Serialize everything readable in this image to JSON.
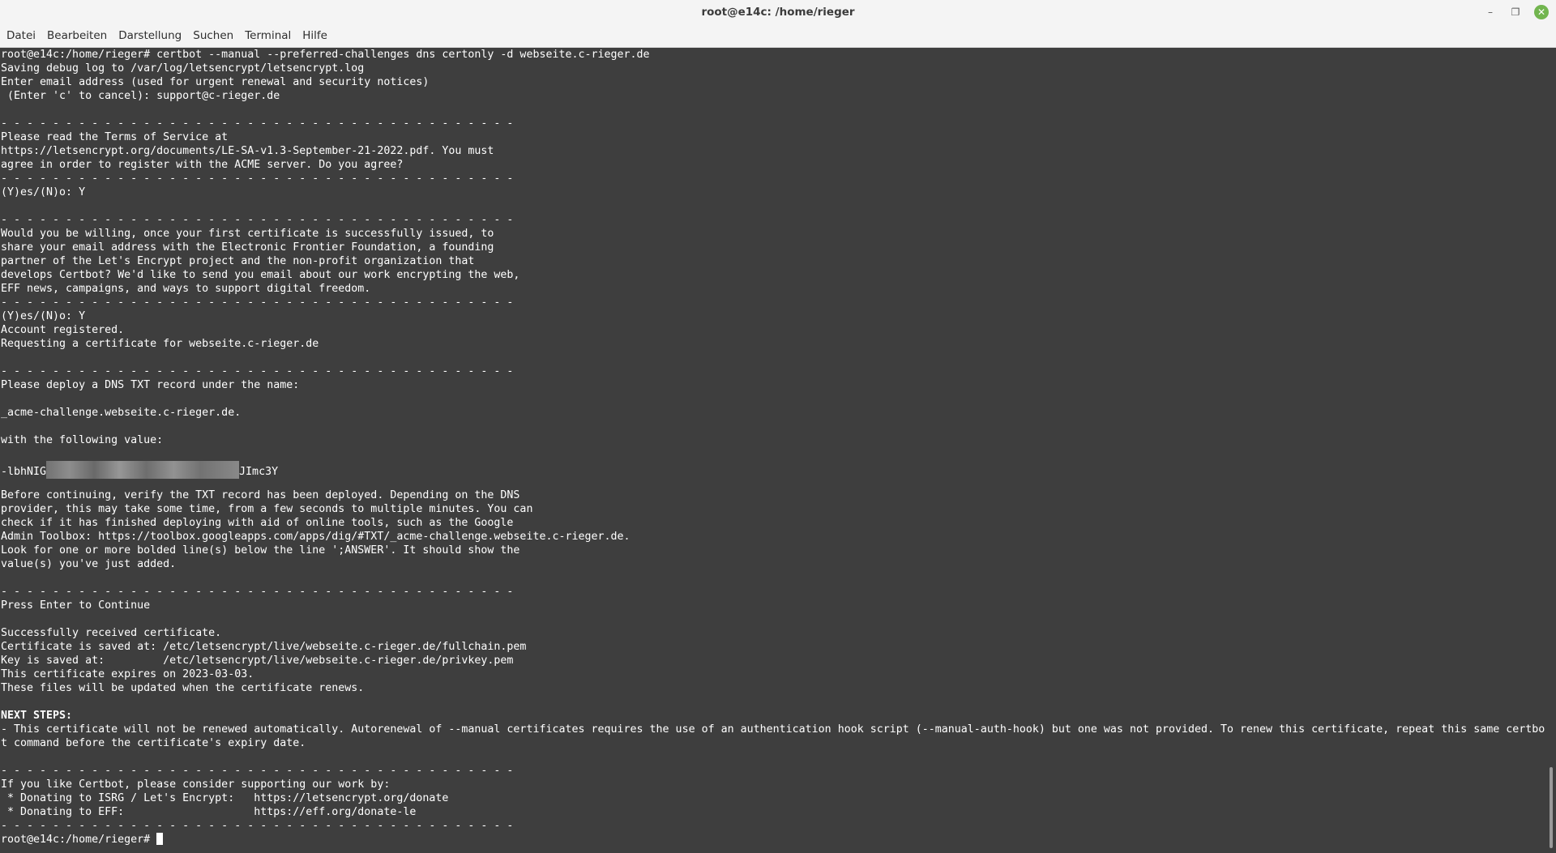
{
  "window": {
    "title": "root@e14c: /home/rieger",
    "minimize_icon": "–",
    "maximize_icon": "❐",
    "close_icon": "✕"
  },
  "menu": {
    "items": [
      "Datei",
      "Bearbeiten",
      "Darstellung",
      "Suchen",
      "Terminal",
      "Hilfe"
    ]
  },
  "terminal": {
    "lines": [
      "root@e14c:/home/rieger# certbot --manual --preferred-challenges dns certonly -d webseite.c-rieger.de",
      "Saving debug log to /var/log/letsencrypt/letsencrypt.log",
      "Enter email address (used for urgent renewal and security notices)",
      " (Enter 'c' to cancel): support@c-rieger.de",
      "",
      "- - - - - - - - - - - - - - - - - - - - - - - - - - - - - - - - - - - - - - - -",
      "Please read the Terms of Service at",
      "https://letsencrypt.org/documents/LE-SA-v1.3-September-21-2022.pdf. You must",
      "agree in order to register with the ACME server. Do you agree?",
      "- - - - - - - - - - - - - - - - - - - - - - - - - - - - - - - - - - - - - - - -",
      "(Y)es/(N)o: Y",
      "",
      "- - - - - - - - - - - - - - - - - - - - - - - - - - - - - - - - - - - - - - - -",
      "Would you be willing, once your first certificate is successfully issued, to",
      "share your email address with the Electronic Frontier Foundation, a founding",
      "partner of the Let's Encrypt project and the non-profit organization that",
      "develops Certbot? We'd like to send you email about our work encrypting the web,",
      "EFF news, campaigns, and ways to support digital freedom.",
      "- - - - - - - - - - - - - - - - - - - - - - - - - - - - - - - - - - - - - - - -",
      "(Y)es/(N)o: Y",
      "Account registered.",
      "Requesting a certificate for webseite.c-rieger.de",
      "",
      "- - - - - - - - - - - - - - - - - - - - - - - - - - - - - - - - - - - - - - - -",
      "Please deploy a DNS TXT record under the name:",
      "",
      "_acme-challenge.webseite.c-rieger.de.",
      "",
      "with the following value:",
      "",
      "",
      "",
      "Before continuing, verify the TXT record has been deployed. Depending on the DNS",
      "provider, this may take some time, from a few seconds to multiple minutes. You can",
      "check if it has finished deploying with aid of online tools, such as the Google",
      "Admin Toolbox: https://toolbox.googleapps.com/apps/dig/#TXT/_acme-challenge.webseite.c-rieger.de.",
      "Look for one or more bolded line(s) below the line ';ANSWER'. It should show the",
      "value(s) you've just added.",
      "",
      "- - - - - - - - - - - - - - - - - - - - - - - - - - - - - - - - - - - - - - - -",
      "Press Enter to Continue",
      "",
      "Successfully received certificate.",
      "Certificate is saved at: /etc/letsencrypt/live/webseite.c-rieger.de/fullchain.pem",
      "Key is saved at:         /etc/letsencrypt/live/webseite.c-rieger.de/privkey.pem",
      "This certificate expires on 2023-03-03.",
      "These files will be updated when the certificate renews.",
      "",
      "",
      "- This certificate will not be renewed automatically. Autorenewal of --manual certificates requires the use of an authentication hook script (--manual-auth-hook) but one was not provided. To renew this certificate, repeat this same certbo",
      "t command before the certificate's expiry date.",
      "",
      "- - - - - - - - - - - - - - - - - - - - - - - - - - - - - - - - - - - - - - - -",
      "If you like Certbot, please consider supporting our work by:",
      " * Donating to ISRG / Let's Encrypt:   https://letsencrypt.org/donate",
      " * Donating to EFF:                    https://eff.org/donate-le",
      "- - - - - - - - - - - - - - - - - - - - - - - - - - - - - - - - - - - - - - - -"
    ],
    "dns_value_prefix": "-lbhNIG",
    "dns_value_suffix": "JImc3Y",
    "next_steps_heading": "NEXT STEPS:",
    "prompt": "root@e14c:/home/rieger# "
  }
}
